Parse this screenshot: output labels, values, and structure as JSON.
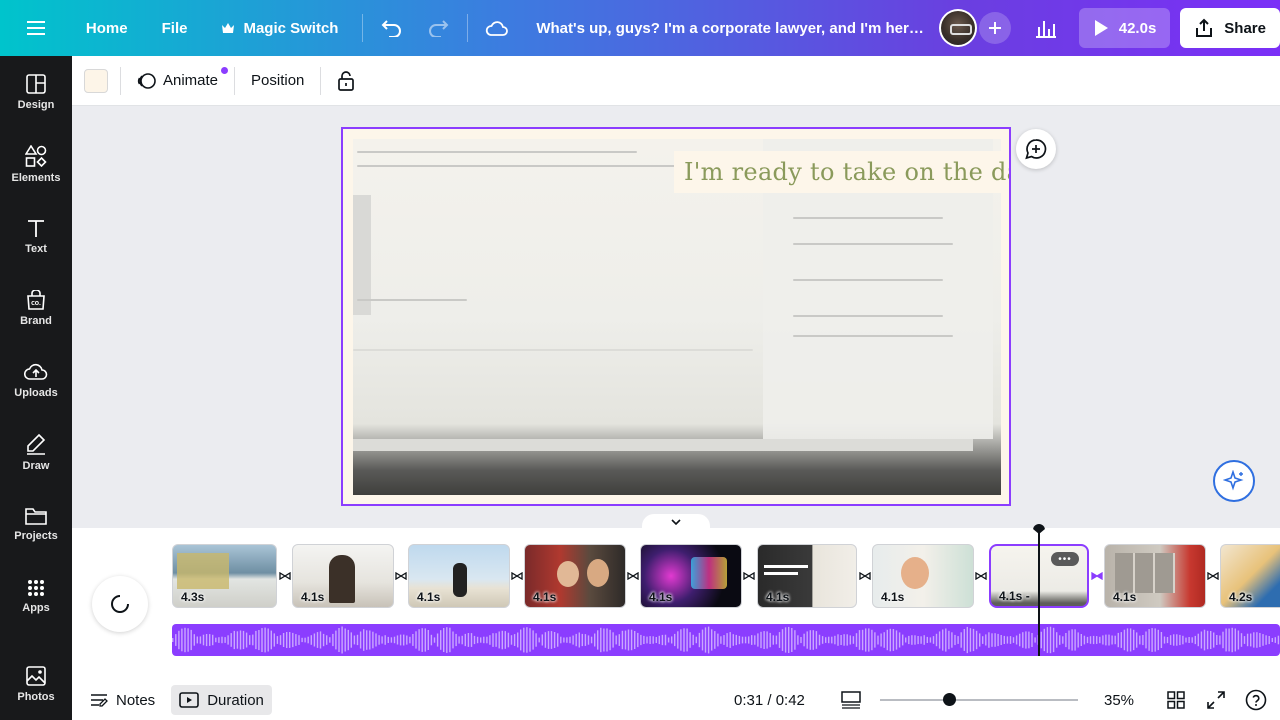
{
  "topbar": {
    "menu_icon": "hamburger-icon",
    "home": "Home",
    "file": "File",
    "magic_switch": "Magic Switch",
    "title": "What's up, guys? I'm a corporate lawyer, and I'm here to ...",
    "play_duration": "42.0s",
    "share": "Share"
  },
  "sidebar": {
    "items": [
      {
        "label": "Design",
        "icon": "design-icon"
      },
      {
        "label": "Elements",
        "icon": "elements-icon"
      },
      {
        "label": "Text",
        "icon": "text-icon"
      },
      {
        "label": "Brand",
        "icon": "brand-icon"
      },
      {
        "label": "Uploads",
        "icon": "uploads-icon"
      },
      {
        "label": "Draw",
        "icon": "draw-icon"
      },
      {
        "label": "Projects",
        "icon": "projects-icon"
      },
      {
        "label": "Apps",
        "icon": "apps-icon"
      },
      {
        "label": "Photos",
        "icon": "photos-icon"
      }
    ]
  },
  "toolbar": {
    "swatch_color": "#fdf5e8",
    "animate": "Animate",
    "position": "Position"
  },
  "canvas": {
    "overlay_text": "I'm ready to take on the day!",
    "accent": "#8b3dff"
  },
  "timeline": {
    "scenes": [
      {
        "duration": "4.3s"
      },
      {
        "duration": "4.1s"
      },
      {
        "duration": "4.1s"
      },
      {
        "duration": "4.1s"
      },
      {
        "duration": "4.1s"
      },
      {
        "duration": "4.1s"
      },
      {
        "duration": "4.1s"
      },
      {
        "duration": "4.1s -"
      },
      {
        "duration": "4.1s"
      },
      {
        "duration": "4.2s"
      }
    ],
    "selected_scene": 8
  },
  "bottombar": {
    "notes": "Notes",
    "duration": "Duration",
    "time": "0:31 / 0:42",
    "zoom": "35%",
    "zoom_level": 0.35
  }
}
